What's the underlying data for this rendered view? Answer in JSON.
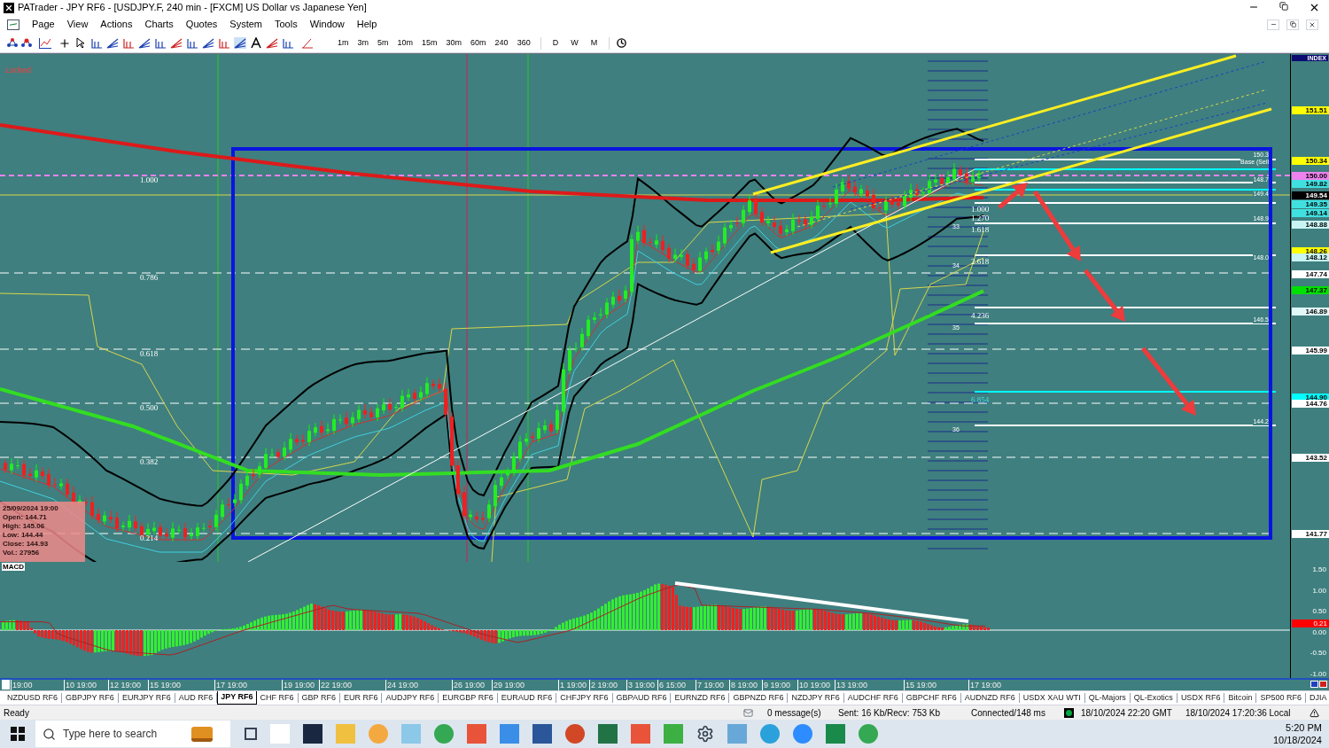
{
  "window": {
    "title": "PATrader - JPY RF6 - [USDJPY.F, 240 min - [FXCM] US Dollar vs Japanese Yen]"
  },
  "menu": [
    "Page",
    "View",
    "Actions",
    "Charts",
    "Quotes",
    "System",
    "Tools",
    "Window",
    "Help"
  ],
  "toolbar": {
    "timeframes": [
      "1m",
      "3m",
      "5m",
      "10m",
      "15m",
      "30m",
      "60m",
      "240",
      "360"
    ],
    "periods": [
      "D",
      "W",
      "M"
    ]
  },
  "chart": {
    "status": "Locked",
    "fib_levels": [
      "1.000",
      "0.786",
      "0.618",
      "0.500",
      "0.382",
      "0.214"
    ],
    "fib_extensions": [
      "1.000",
      "1.270",
      "1.618",
      "2.618",
      "4.236",
      "6.854"
    ],
    "wave_counts": [
      "33",
      "34",
      "35",
      "36"
    ],
    "level_tags": [
      "150.3",
      "Base (Sell",
      "148.7",
      "149.4",
      "148.9",
      "148.0",
      "146.5",
      "144.2"
    ],
    "price_axis": {
      "header": "INDEX",
      "labels": [
        {
          "text": "151.51",
          "color": "#ffff00"
        },
        {
          "text": "150.34",
          "color": "#ffff00"
        },
        {
          "text": "150.00",
          "color": "#ee82ee"
        },
        {
          "text": "149.82",
          "color": "#40e0e0"
        },
        {
          "text": "149.54",
          "color": "#000000"
        },
        {
          "text": "149.35",
          "color": "#40e0e0"
        },
        {
          "text": "149.14",
          "color": "#40e0e0"
        },
        {
          "text": "148.88",
          "color": "#c8f4f4"
        },
        {
          "text": "148.26",
          "color": "#ffff00"
        },
        {
          "text": "148.12",
          "color": "#c8f4f4"
        },
        {
          "text": "147.74",
          "color": "#ffffff"
        },
        {
          "text": "147.37",
          "color": "#00e000"
        },
        {
          "text": "146.89",
          "color": "#e0f8f8"
        },
        {
          "text": "145.99",
          "color": "#ffffff"
        },
        {
          "text": "144.90",
          "color": "#00ffff"
        },
        {
          "text": "144.76",
          "color": "#ffffff"
        },
        {
          "text": "143.52",
          "color": "#ffffff"
        },
        {
          "text": "141.77",
          "color": "#ffffff"
        }
      ]
    },
    "data_box": {
      "date": "25/09/2024 19:00",
      "lines": [
        "Open: 144.71",
        "High: 145.06",
        "Low: 144.44",
        "Close: 144.93",
        "Vol.: 27956"
      ]
    }
  },
  "macd": {
    "title": "MACD",
    "axis": [
      "1.50",
      "1.00",
      "0.50",
      "0.00",
      "-0.50",
      "-1.00"
    ],
    "badge": {
      "text": "0.21",
      "color": "#ff0000"
    }
  },
  "time_axis": [
    "19:00",
    "10 19:00",
    "12 19:00",
    "15 19:00",
    "17 19:00",
    "19 19:00",
    "22 19:00",
    "24 19:00",
    "26 19:00",
    "29 19:00",
    "1 19:00",
    "2 19:00",
    "3 19:00",
    "6 15:00",
    "7 19:00",
    "8 19:00",
    "9 19:00",
    "10 19:00",
    "13 19:00",
    "15 19:00",
    "17 19:00"
  ],
  "tabs": [
    {
      "label": "NZDUSD RF6",
      "selected": false
    },
    {
      "label": "GBPJPY RF6",
      "selected": false
    },
    {
      "label": "EURJPY RF6",
      "selected": false
    },
    {
      "label": "AUD RF6",
      "selected": false
    },
    {
      "label": "JPY RF6",
      "selected": true
    },
    {
      "label": "CHF RF6",
      "selected": false
    },
    {
      "label": "GBP RF6",
      "selected": false
    },
    {
      "label": "EUR RF6",
      "selected": false
    },
    {
      "label": "AUDJPY RF6",
      "selected": false
    },
    {
      "label": "EURGBP RF6",
      "selected": false
    },
    {
      "label": "EURAUD RF6",
      "selected": false
    },
    {
      "label": "CHFJPY RF6",
      "selected": false
    },
    {
      "label": "GBPAUD RF6",
      "selected": false
    },
    {
      "label": "EURNZD RF6",
      "selected": false
    },
    {
      "label": "GBPNZD RF6",
      "selected": false
    },
    {
      "label": "NZDJPY RF6",
      "selected": false
    },
    {
      "label": "AUDCHF RF6",
      "selected": false
    },
    {
      "label": "GBPCHF RF6",
      "selected": false
    },
    {
      "label": "AUDNZD RF6",
      "selected": false
    },
    {
      "label": "USDX XAU WTI",
      "selected": false
    },
    {
      "label": "QL-Majors",
      "selected": false
    },
    {
      "label": "QL-Exotics",
      "selected": false
    },
    {
      "label": "USDX  RF6",
      "selected": false
    },
    {
      "label": "Bitcoin",
      "selected": false
    },
    {
      "label": "SP500 RF6",
      "selected": false
    },
    {
      "label": "DJIA",
      "selected": false
    }
  ],
  "status_bar": {
    "state": "Ready",
    "messages": "0 message(s)",
    "traffic": "Sent: 16 Kb/Recv: 753 Kb",
    "connection": "Connected/148 ms",
    "gmt": "18/10/2024 22:20 GMT",
    "local": "18/10/2024 17:20:36 Local"
  },
  "taskbar": {
    "search_placeholder": "Type here to search",
    "time": "5:20 PM",
    "date": "10/18/2024"
  }
}
